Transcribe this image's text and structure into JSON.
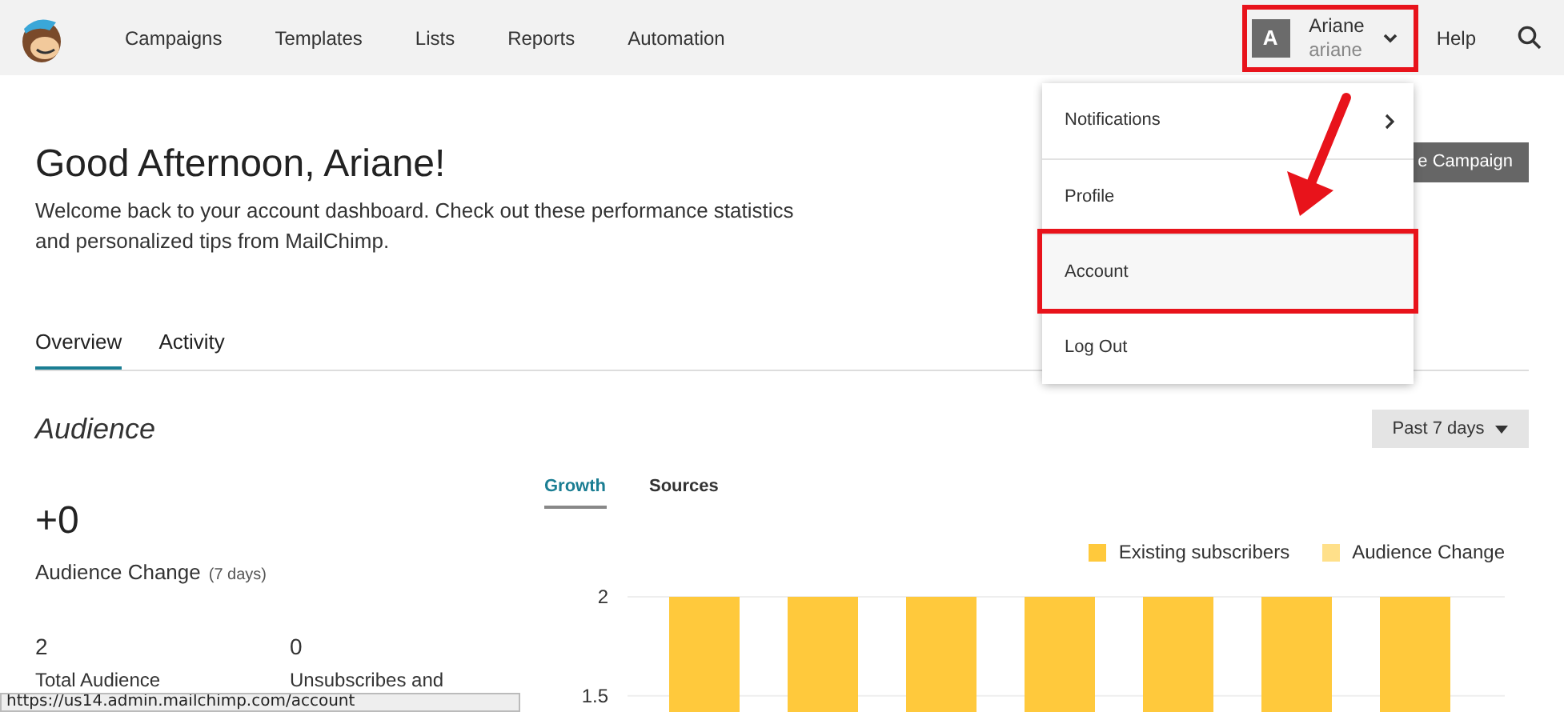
{
  "nav": {
    "items": [
      {
        "label": "Campaigns"
      },
      {
        "label": "Templates"
      },
      {
        "label": "Lists"
      },
      {
        "label": "Reports"
      },
      {
        "label": "Automation"
      }
    ],
    "user": {
      "initial": "A",
      "name": "Ariane",
      "username": "ariane",
      "expanded": true,
      "highlighted": true
    },
    "help": "Help"
  },
  "user_menu": [
    {
      "label": "Notifications",
      "submenu": true,
      "highlighted": false
    },
    {
      "label": "Profile",
      "submenu": false,
      "highlighted": false
    },
    {
      "label": "Account",
      "submenu": false,
      "highlighted": true
    },
    {
      "label": "Log Out",
      "submenu": false,
      "highlighted": false
    }
  ],
  "greeting": {
    "title": "Good Afternoon, Ariane!",
    "text": "Welcome back to your account dashboard. Check out these performance statistics and personalized tips from MailChimp.",
    "button": "e Campaign"
  },
  "tabs": [
    {
      "label": "Overview",
      "selected": true
    },
    {
      "label": "Activity",
      "selected": false
    }
  ],
  "audience": {
    "title": "Audience",
    "range": "Past 7 days",
    "change": "+0",
    "change_label": "Audience Change",
    "change_period": "(7 days)",
    "stats": [
      {
        "value": "2",
        "label": "Total Audience"
      },
      {
        "value": "0",
        "label": "Unsubscribes and"
      }
    ]
  },
  "chart_tabs": [
    {
      "label": "Growth",
      "selected": true
    },
    {
      "label": "Sources",
      "selected": false
    }
  ],
  "chart_data": {
    "type": "bar",
    "ylim": [
      1.41,
      2
    ],
    "yticks": [
      {
        "value": 2,
        "label": "2"
      },
      {
        "value": 1.5,
        "label": "1.5"
      }
    ],
    "series": [
      {
        "name": "Existing subscribers",
        "color": "#ffc93c",
        "values": [
          2,
          2,
          2,
          2,
          2,
          2,
          2
        ]
      },
      {
        "name": "Audience Change",
        "color": "#ffe08a",
        "values": [
          null,
          null,
          null,
          null,
          null,
          null,
          null
        ]
      }
    ]
  },
  "status_url": "https://us14.admin.mailchimp.com/account"
}
